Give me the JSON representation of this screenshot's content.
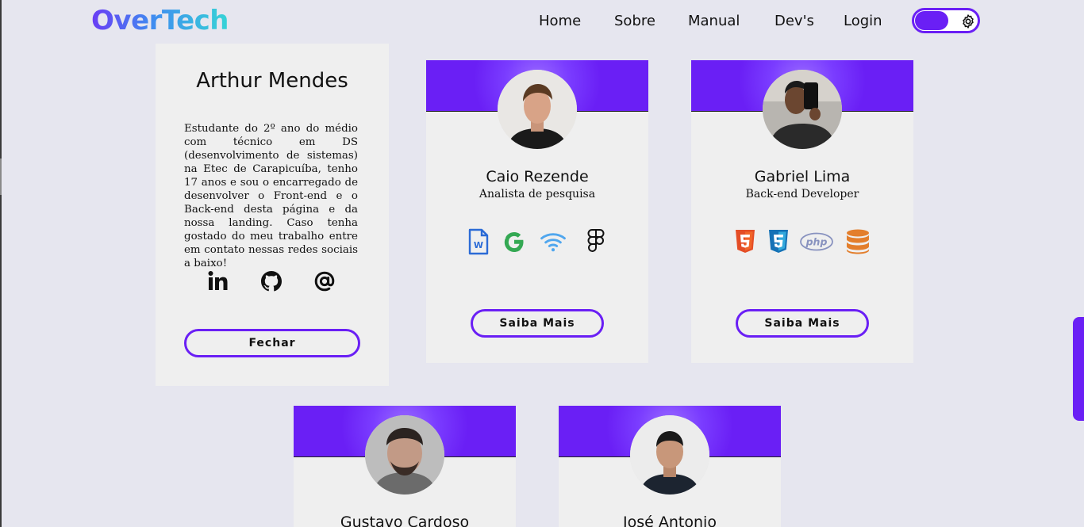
{
  "header": {
    "logo": "OverTech",
    "nav": [
      "Home",
      "Sobre",
      "Manual",
      "Dev's",
      "Login"
    ],
    "theme_toggle_icon": "gear-icon"
  },
  "profile_panel": {
    "name": "Arthur Mendes",
    "bio": "Estudante do 2º ano do médio com técnico em DS (desenvolvimento de sistemas) na Etec de Carapicuíba, tenho 17 anos e sou o encarregado de desenvolver o Front-end e o Back-end desta página e da nossa landing. Caso tenha gostado do meu trabalho entre em contato nessas redes sociais a baixo!",
    "social_icons": [
      "linkedin-icon",
      "github-icon",
      "at-sign-icon"
    ],
    "close_label": "Fechar"
  },
  "cards": [
    {
      "name": "Caio Rezende",
      "role": "Analista de pesquisa",
      "skills": [
        "word-icon",
        "google-icon",
        "wifi-icon",
        "figma-icon"
      ],
      "button": "Saiba Mais"
    },
    {
      "name": "Gabriel Lima",
      "role": "Back-end Developer",
      "skills": [
        "html5-icon",
        "css3-icon",
        "php-icon",
        "database-icon"
      ],
      "button": "Saiba Mais"
    },
    {
      "name": "Gustavo Cardoso"
    },
    {
      "name": "José Antonio"
    }
  ],
  "colors": {
    "accent": "#6a1ff5",
    "background": "#e6e6ef",
    "card": "#efefef"
  }
}
